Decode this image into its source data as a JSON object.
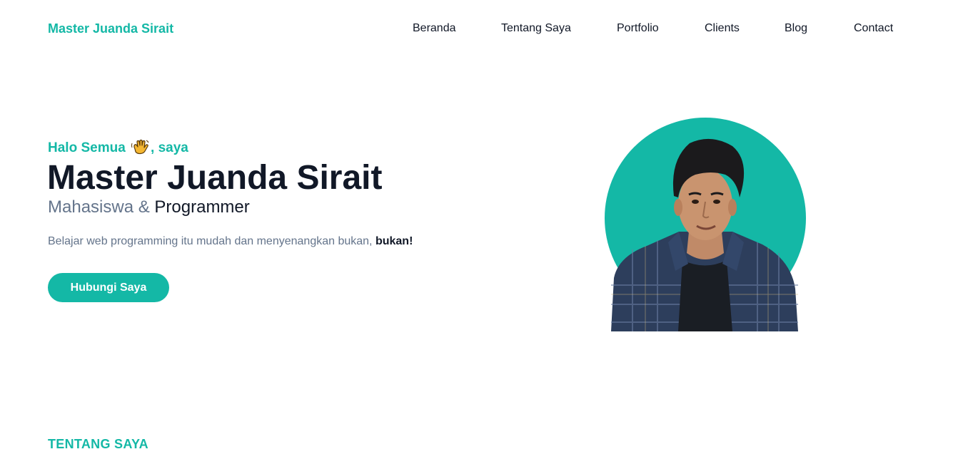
{
  "navbar": {
    "brand": "Master Juanda Sirait",
    "links": [
      {
        "label": "Beranda"
      },
      {
        "label": "Tentang Saya"
      },
      {
        "label": "Portfolio"
      },
      {
        "label": "Clients"
      },
      {
        "label": "Blog"
      },
      {
        "label": "Contact"
      }
    ]
  },
  "hero": {
    "greeting_before": "Halo Semua",
    "greeting_icon": "waving-hand-icon",
    "greeting_after": ", saya",
    "name": "Master Juanda Sirait",
    "role_primary": "Mahasiswa &",
    "role_secondary": "Programmer",
    "description": "Belajar web programming itu mudah dan menyenangkan bukan,",
    "description_emphasis": "bukan!",
    "cta_label": "Hubungi Saya",
    "portrait_icon": "profile-photo",
    "accent_color": "#14b8a6"
  },
  "about": {
    "section_title": "TENTANG SAYA"
  }
}
